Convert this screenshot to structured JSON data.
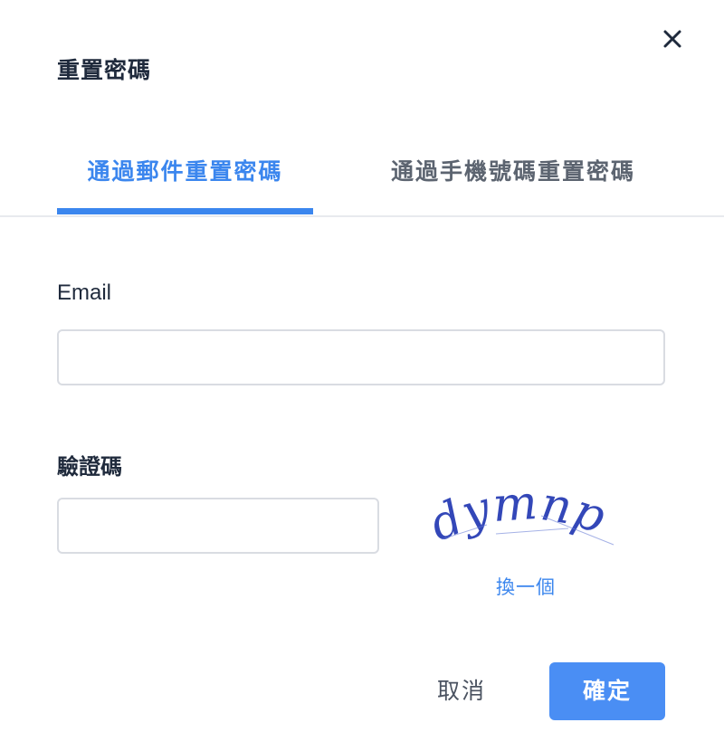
{
  "dialog": {
    "title": "重置密碼",
    "close_icon": "close-icon"
  },
  "tabs": [
    {
      "label": "通過郵件重置密碼",
      "active": true
    },
    {
      "label": "通過手機號碼重置密碼",
      "active": false
    }
  ],
  "form": {
    "email_label": "Email",
    "email_value": "",
    "captcha_label": "驗證碼",
    "captcha_value": "",
    "captcha_text": "dymnp",
    "refresh_label": "換一個"
  },
  "actions": {
    "cancel_label": "取消",
    "confirm_label": "確定"
  },
  "colors": {
    "accent": "#3b86ee",
    "primary_button": "#4a8ef4",
    "captcha_ink": "#3347b8"
  }
}
